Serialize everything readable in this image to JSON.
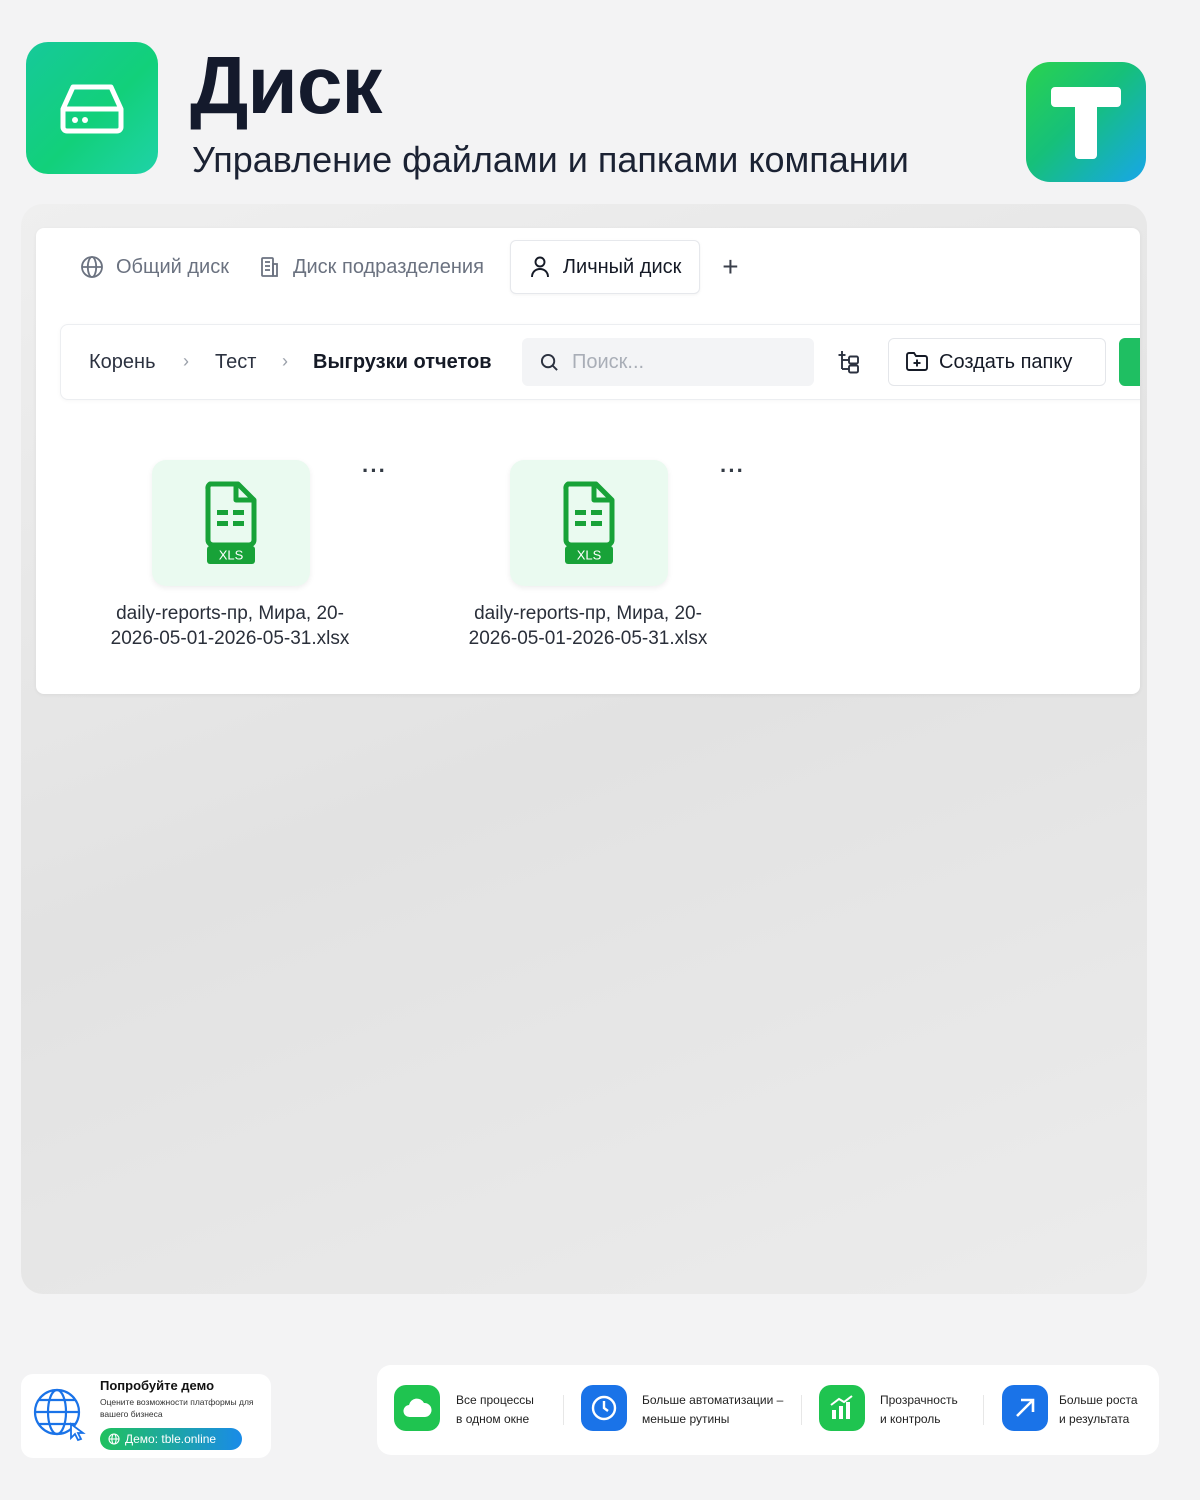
{
  "header": {
    "title": "Диск",
    "subtitle": "Управление файлами и папками компании",
    "app_icon": "drive-icon",
    "brand_logo": "t-letter-logo",
    "colors": {
      "green_accent": "#12d07a",
      "blue_accent": "#17a6e9"
    }
  },
  "tabs": [
    {
      "label": "Общий диск",
      "icon": "globe-icon"
    },
    {
      "label": "Диск подразделения",
      "icon": "building-icon"
    },
    {
      "label": "Личный диск",
      "icon": "user-icon",
      "active": true
    }
  ],
  "tab_add_label": "+",
  "breadcrumb": [
    "Корень",
    "Тест",
    "Выгрузки отчетов"
  ],
  "breadcrumb_separator": "›",
  "search": {
    "placeholder": "Поиск..."
  },
  "toolbar": {
    "create_folder_label": "Создать папку"
  },
  "files": [
    {
      "name_line1": "daily-reports-пр, Мира, 20-",
      "name_line2": "2026-05-01-2026-05-31.xlsx",
      "badge": "XLS",
      "more": "···"
    },
    {
      "name_line1": "daily-reports-пр, Мира, 20-",
      "name_line2": "2026-05-01-2026-05-31.xlsx",
      "badge": "XLS",
      "more": "···"
    }
  ],
  "demo": {
    "title": "Попробуйте демо",
    "desc": "Оцените возможности платформы для вашего бизнеса",
    "button": "Демо: tble.online"
  },
  "benefits": [
    {
      "line1": "Все процессы",
      "line2": "в одном окне",
      "icon": "cloud-icon",
      "color": "#1fc450"
    },
    {
      "line1": "Больше автоматизации –",
      "line2": "меньше рутины",
      "icon": "clock-icon",
      "color": "#1a73e8"
    },
    {
      "line1": "Прозрачность",
      "line2": "и контроль",
      "icon": "chart-icon",
      "color": "#1fc450"
    },
    {
      "line1": "Больше роста",
      "line2": "и результата",
      "icon": "arrow-up-right-icon",
      "color": "#1a73e8"
    }
  ]
}
